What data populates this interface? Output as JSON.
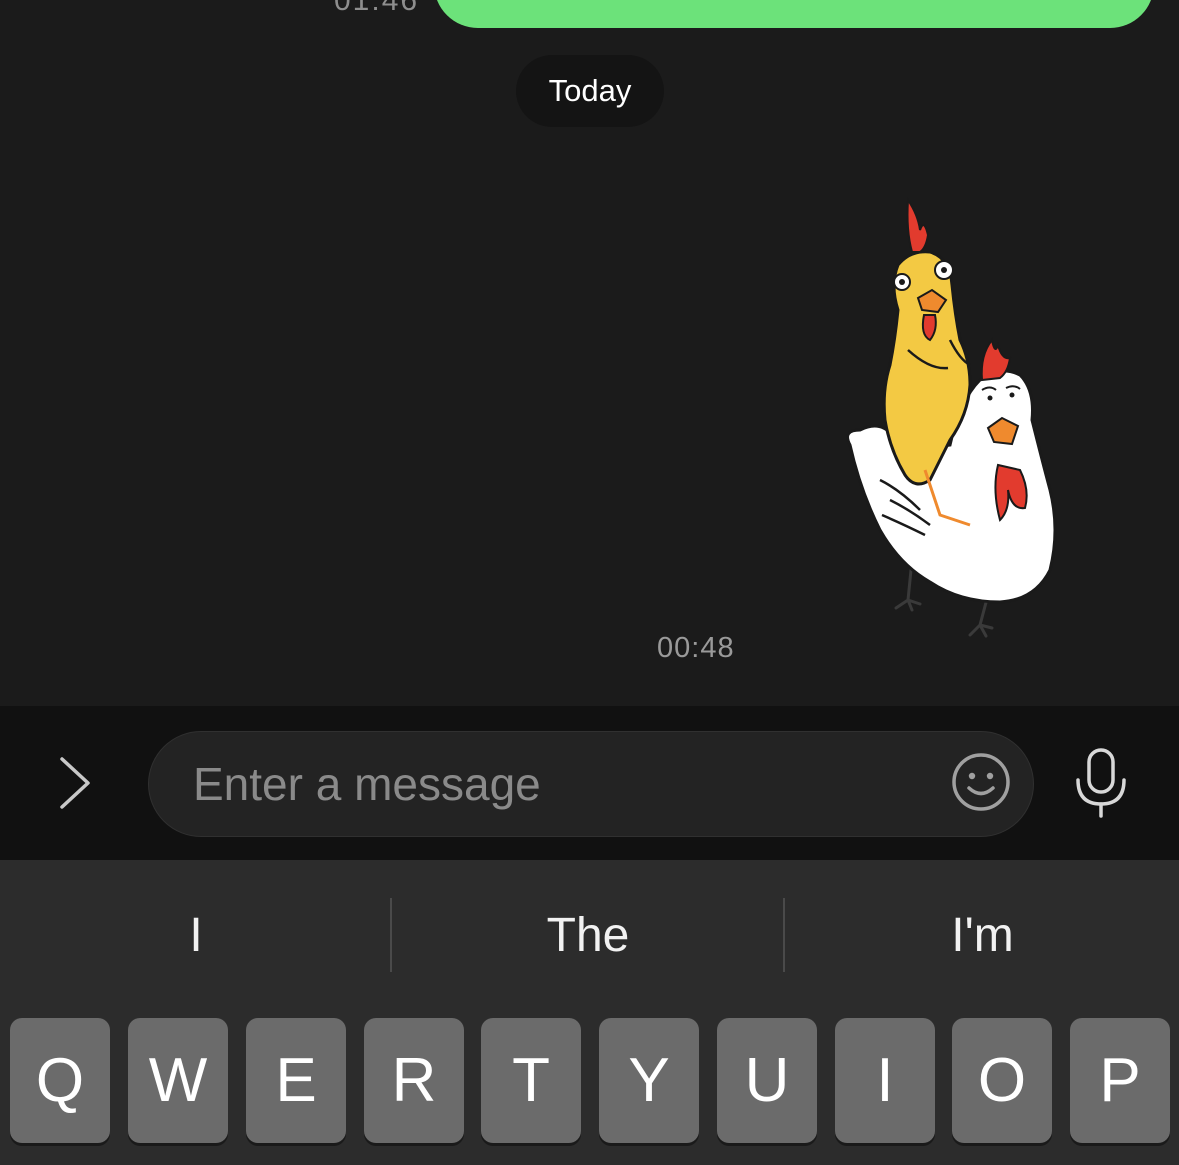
{
  "chat": {
    "previous_message_time": "01:46",
    "previous_bubble_color": "#6ce27a",
    "date_separator": "Today",
    "sticker": {
      "description_icon": "chicken-riding-rooster-sticker"
    },
    "message_time": "00:48"
  },
  "composer": {
    "expand_icon": "chevron-right-icon",
    "input_placeholder": "Enter a message",
    "input_value": "",
    "emoji_icon": "smiley-icon",
    "mic_icon": "microphone-icon"
  },
  "keyboard": {
    "suggestions": [
      "I",
      "The",
      "I'm"
    ],
    "row1": [
      "Q",
      "W",
      "E",
      "R",
      "T",
      "Y",
      "U",
      "I",
      "O",
      "P"
    ]
  },
  "colors": {
    "chat_background": "#1b1b1b",
    "composer_background": "#111111",
    "keyboard_background": "#2c2c2c",
    "key_background": "#6b6b6b"
  }
}
